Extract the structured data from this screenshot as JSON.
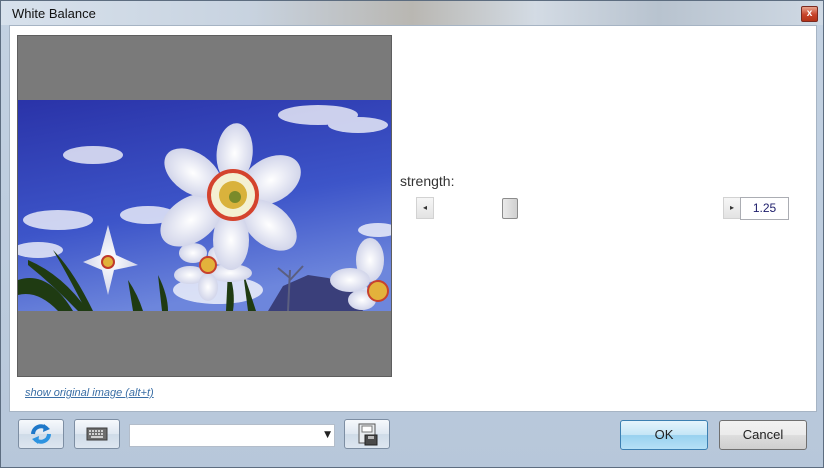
{
  "window": {
    "title": "White Balance",
    "close_glyph": "x"
  },
  "preview": {
    "show_original_link": "show original image (alt+t)"
  },
  "strength": {
    "label": "strength:",
    "value": "1.25",
    "slider_fraction": 0.28,
    "left_arrow": "◂",
    "right_arrow": "▸"
  },
  "toolbar": {
    "refresh_icon": "refresh-icon",
    "keyboard_icon": "keyboard-icon",
    "preset_selected": "",
    "combo_arrow": "▼",
    "save_icon": "save-icon"
  },
  "buttons": {
    "ok_label": "OK",
    "cancel_label": "Cancel"
  },
  "colors": {
    "ok_accent": "#3c7fb1",
    "sky": "#2f3fb0",
    "link": "#3a6ea5"
  }
}
